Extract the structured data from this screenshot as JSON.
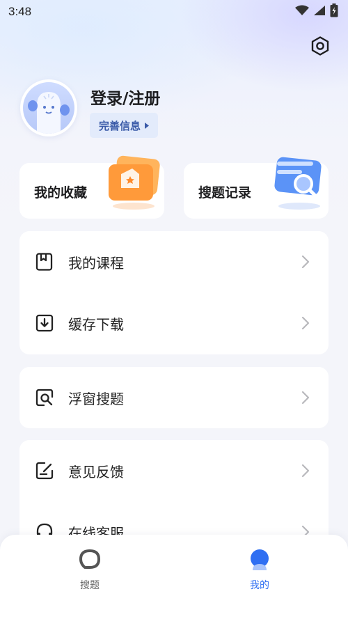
{
  "status_bar": {
    "time": "3:48"
  },
  "profile": {
    "login_label": "登录/注册",
    "complete_info_label": "完善信息"
  },
  "quick_cards": [
    {
      "label": "我的收藏"
    },
    {
      "label": "搜题记录"
    }
  ],
  "menu_groups": [
    {
      "items": [
        {
          "label": "我的课程"
        },
        {
          "label": "缓存下载"
        }
      ]
    },
    {
      "items": [
        {
          "label": "浮窗搜题"
        }
      ]
    },
    {
      "items": [
        {
          "label": "意见反馈"
        },
        {
          "label": "在线客服"
        }
      ]
    }
  ],
  "tabbar": {
    "tabs": [
      {
        "label": "搜题",
        "active": false
      },
      {
        "label": "我的",
        "active": true
      }
    ]
  },
  "colors": {
    "accent": "#2f6ff2",
    "pill_text": "#3a5aa8",
    "page_bg": "#f4f5fa"
  },
  "icons": {
    "settings": "hexagon-settings-icon",
    "course": "bookmark-book-icon",
    "download": "download-box-icon",
    "float_search": "search-frame-icon",
    "feedback": "edit-note-icon",
    "service": "headset-icon"
  }
}
